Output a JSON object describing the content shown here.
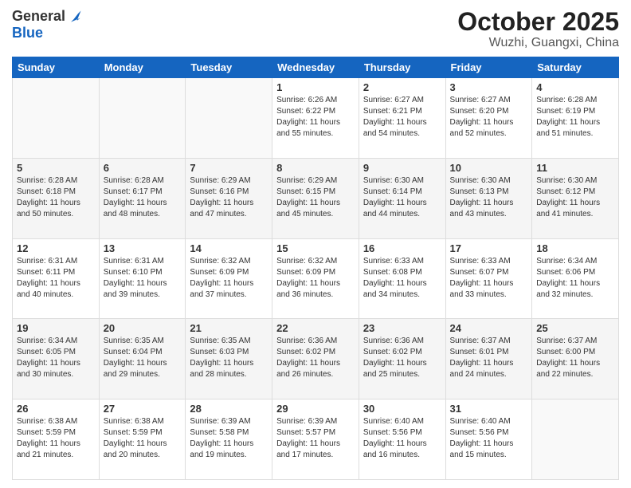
{
  "logo": {
    "general": "General",
    "blue": "Blue"
  },
  "title": "October 2025",
  "location": "Wuzhi, Guangxi, China",
  "days_header": [
    "Sunday",
    "Monday",
    "Tuesday",
    "Wednesday",
    "Thursday",
    "Friday",
    "Saturday"
  ],
  "weeks": [
    [
      {
        "day": "",
        "info": ""
      },
      {
        "day": "",
        "info": ""
      },
      {
        "day": "",
        "info": ""
      },
      {
        "day": "1",
        "info": "Sunrise: 6:26 AM\nSunset: 6:22 PM\nDaylight: 11 hours\nand 55 minutes."
      },
      {
        "day": "2",
        "info": "Sunrise: 6:27 AM\nSunset: 6:21 PM\nDaylight: 11 hours\nand 54 minutes."
      },
      {
        "day": "3",
        "info": "Sunrise: 6:27 AM\nSunset: 6:20 PM\nDaylight: 11 hours\nand 52 minutes."
      },
      {
        "day": "4",
        "info": "Sunrise: 6:28 AM\nSunset: 6:19 PM\nDaylight: 11 hours\nand 51 minutes."
      }
    ],
    [
      {
        "day": "5",
        "info": "Sunrise: 6:28 AM\nSunset: 6:18 PM\nDaylight: 11 hours\nand 50 minutes."
      },
      {
        "day": "6",
        "info": "Sunrise: 6:28 AM\nSunset: 6:17 PM\nDaylight: 11 hours\nand 48 minutes."
      },
      {
        "day": "7",
        "info": "Sunrise: 6:29 AM\nSunset: 6:16 PM\nDaylight: 11 hours\nand 47 minutes."
      },
      {
        "day": "8",
        "info": "Sunrise: 6:29 AM\nSunset: 6:15 PM\nDaylight: 11 hours\nand 45 minutes."
      },
      {
        "day": "9",
        "info": "Sunrise: 6:30 AM\nSunset: 6:14 PM\nDaylight: 11 hours\nand 44 minutes."
      },
      {
        "day": "10",
        "info": "Sunrise: 6:30 AM\nSunset: 6:13 PM\nDaylight: 11 hours\nand 43 minutes."
      },
      {
        "day": "11",
        "info": "Sunrise: 6:30 AM\nSunset: 6:12 PM\nDaylight: 11 hours\nand 41 minutes."
      }
    ],
    [
      {
        "day": "12",
        "info": "Sunrise: 6:31 AM\nSunset: 6:11 PM\nDaylight: 11 hours\nand 40 minutes."
      },
      {
        "day": "13",
        "info": "Sunrise: 6:31 AM\nSunset: 6:10 PM\nDaylight: 11 hours\nand 39 minutes."
      },
      {
        "day": "14",
        "info": "Sunrise: 6:32 AM\nSunset: 6:09 PM\nDaylight: 11 hours\nand 37 minutes."
      },
      {
        "day": "15",
        "info": "Sunrise: 6:32 AM\nSunset: 6:09 PM\nDaylight: 11 hours\nand 36 minutes."
      },
      {
        "day": "16",
        "info": "Sunrise: 6:33 AM\nSunset: 6:08 PM\nDaylight: 11 hours\nand 34 minutes."
      },
      {
        "day": "17",
        "info": "Sunrise: 6:33 AM\nSunset: 6:07 PM\nDaylight: 11 hours\nand 33 minutes."
      },
      {
        "day": "18",
        "info": "Sunrise: 6:34 AM\nSunset: 6:06 PM\nDaylight: 11 hours\nand 32 minutes."
      }
    ],
    [
      {
        "day": "19",
        "info": "Sunrise: 6:34 AM\nSunset: 6:05 PM\nDaylight: 11 hours\nand 30 minutes."
      },
      {
        "day": "20",
        "info": "Sunrise: 6:35 AM\nSunset: 6:04 PM\nDaylight: 11 hours\nand 29 minutes."
      },
      {
        "day": "21",
        "info": "Sunrise: 6:35 AM\nSunset: 6:03 PM\nDaylight: 11 hours\nand 28 minutes."
      },
      {
        "day": "22",
        "info": "Sunrise: 6:36 AM\nSunset: 6:02 PM\nDaylight: 11 hours\nand 26 minutes."
      },
      {
        "day": "23",
        "info": "Sunrise: 6:36 AM\nSunset: 6:02 PM\nDaylight: 11 hours\nand 25 minutes."
      },
      {
        "day": "24",
        "info": "Sunrise: 6:37 AM\nSunset: 6:01 PM\nDaylight: 11 hours\nand 24 minutes."
      },
      {
        "day": "25",
        "info": "Sunrise: 6:37 AM\nSunset: 6:00 PM\nDaylight: 11 hours\nand 22 minutes."
      }
    ],
    [
      {
        "day": "26",
        "info": "Sunrise: 6:38 AM\nSunset: 5:59 PM\nDaylight: 11 hours\nand 21 minutes."
      },
      {
        "day": "27",
        "info": "Sunrise: 6:38 AM\nSunset: 5:59 PM\nDaylight: 11 hours\nand 20 minutes."
      },
      {
        "day": "28",
        "info": "Sunrise: 6:39 AM\nSunset: 5:58 PM\nDaylight: 11 hours\nand 19 minutes."
      },
      {
        "day": "29",
        "info": "Sunrise: 6:39 AM\nSunset: 5:57 PM\nDaylight: 11 hours\nand 17 minutes."
      },
      {
        "day": "30",
        "info": "Sunrise: 6:40 AM\nSunset: 5:56 PM\nDaylight: 11 hours\nand 16 minutes."
      },
      {
        "day": "31",
        "info": "Sunrise: 6:40 AM\nSunset: 5:56 PM\nDaylight: 11 hours\nand 15 minutes."
      },
      {
        "day": "",
        "info": ""
      }
    ]
  ]
}
